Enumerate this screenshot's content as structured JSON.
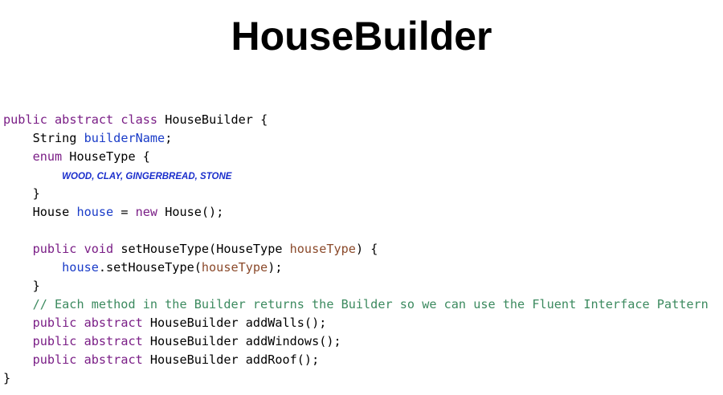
{
  "title": "HouseBuilder",
  "colors": {
    "keyword": "#7a1e86",
    "field": "#1a3cc8",
    "parameter": "#8b4a2b",
    "comment": "#3c8a5f",
    "enum_constant": "#1a2ecc",
    "text": "#000000"
  },
  "code": {
    "l1_kw1": "public",
    "l1_kw2": "abstract",
    "l1_kw3": "class",
    "l1_rest": " HouseBuilder {",
    "l2_type": "String",
    "l2_field": "builderName",
    "l2_end": ";",
    "l3_kw": "enum",
    "l3_rest": " HouseType {",
    "l4_enum_values": "WOOD, CLAY, GINGERBREAD, STONE",
    "l5_close": "}",
    "l6_type": "House",
    "l6_field": "house",
    "l6_eq": " = ",
    "l6_kw": "new",
    "l6_rest": " House();",
    "l8_kw1": "public",
    "l8_kw2": "void",
    "l8_method": " setHouseType(HouseType ",
    "l8_param": "houseType",
    "l8_end": ") {",
    "l9_field": "house",
    "l9_call": ".setHouseType(",
    "l9_param": "houseType",
    "l9_end": ");",
    "l10_close": "}",
    "l11_comment": "// Each method in the Builder returns the Builder so we can use the Fluent Interface Pattern",
    "l12_kw1": "public",
    "l12_kw2": "abstract",
    "l12_rest": " HouseBuilder addWalls();",
    "l13_kw1": "public",
    "l13_kw2": "abstract",
    "l13_rest": " HouseBuilder addWindows();",
    "l14_kw1": "public",
    "l14_kw2": "abstract",
    "l14_rest": " HouseBuilder addRoof();",
    "l15_close": "}"
  }
}
